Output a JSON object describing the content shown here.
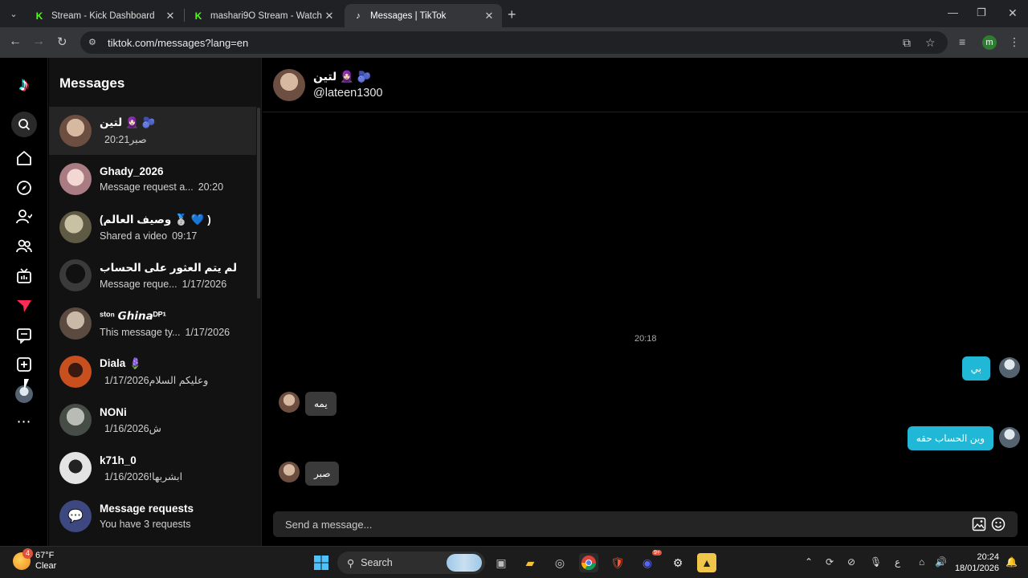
{
  "browser": {
    "tabs": [
      {
        "title": "Stream - Kick Dashboard",
        "favicon": "kick-icon"
      },
      {
        "title": "mashari9O Stream - Watch Live",
        "favicon": "kick-icon"
      },
      {
        "title": "Messages | TikTok",
        "favicon": "tiktok-icon",
        "active": true
      }
    ],
    "url": "tiktok.com/messages?lang=en",
    "profile_initial": "m"
  },
  "sidebar": {
    "heading": "Messages",
    "conversations": [
      {
        "name": "لتين 🧕🏻 🫐",
        "preview": "صبر",
        "time": "20:21",
        "selected": true,
        "avatar_color": "#8a6a5a"
      },
      {
        "name": "Ghady_2026",
        "preview": "Message request a...",
        "time": "20:20",
        "avatar_color": "#c9a4a8"
      },
      {
        "name": "(وصيف العالم 🥈 💙 )",
        "preview": "Shared a video",
        "time": "09:17",
        "avatar_color": "#8c8a6e"
      },
      {
        "name": "لم يتم العثور على الحساب",
        "preview": "Message reque...",
        "time": "1/17/2026",
        "avatar_color": "#2a2a2a"
      },
      {
        "name": "ˢᵗᵒⁿ 𝙂𝙝𝙞𝙣𝙖ᴰᴾ¹",
        "preview": "This message ty...",
        "time": "1/17/2026",
        "avatar_color": "#7d6a5e"
      },
      {
        "name": "Diala 🪻",
        "preview": "وعليكم السلام",
        "time": "1/17/2026",
        "avatar_color": "#c24a1c"
      },
      {
        "name": "NONi",
        "preview": "ش",
        "time": "1/16/2026",
        "avatar_color": "#555d55"
      },
      {
        "name": "k71h_0",
        "preview": "ابشربها!",
        "time": "1/16/2026",
        "avatar_color": "#d8d8d8"
      }
    ],
    "requests": {
      "title": "Message requests",
      "subtitle": "You have 3 requests"
    }
  },
  "chat": {
    "name": "لتين 🧕🏻 🫐",
    "handle": "@lateen1300",
    "timestamp": "20:18",
    "messages": [
      {
        "direction": "out",
        "text": "بي"
      },
      {
        "direction": "in",
        "text": "يمه"
      },
      {
        "direction": "out",
        "text": "وين الحساب حقه"
      },
      {
        "direction": "in",
        "text": "صبر"
      }
    ],
    "composer_placeholder": "Send a message..."
  },
  "taskbar": {
    "weather_temp": "67°F",
    "weather_desc": "Clear",
    "weather_badge": "4",
    "search_label": "Search",
    "discord_badge": "9+",
    "lang": "ع",
    "time": "20:24",
    "date": "18/01/2026"
  }
}
